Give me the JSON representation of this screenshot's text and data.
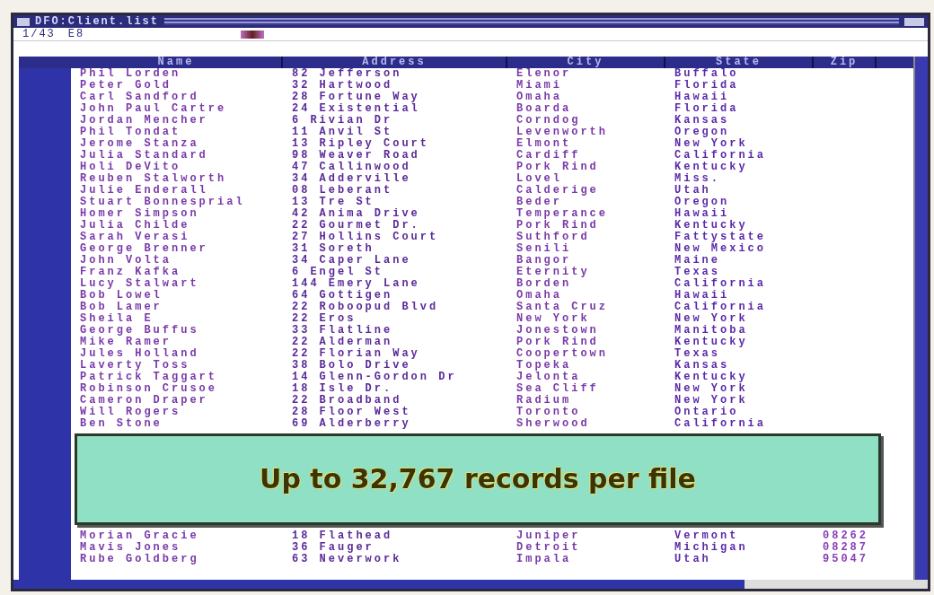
{
  "window": {
    "title": "DFO:Client.list",
    "record_position": "1/43",
    "field_code": "E8"
  },
  "table": {
    "columns": [
      "Name",
      "Address",
      "City",
      "State",
      "Zip"
    ],
    "rows": [
      {
        "name": "Phil Lorden",
        "address": "82 Jefferson",
        "city": "Elenor",
        "state": "Buffalo"
      },
      {
        "name": "Peter Gold",
        "address": "32 Hartwood",
        "city": "Miami",
        "state": "Florida"
      },
      {
        "name": "Carl Sandford",
        "address": "28 Fortune Way",
        "city": "Omaha",
        "state": "Hawaii"
      },
      {
        "name": "John Paul Cartre",
        "address": "24 Existential",
        "city": "Boarda",
        "state": "Florida"
      },
      {
        "name": "Jordan Mencher",
        "address": "6 Rivian Dr",
        "city": "Corndog",
        "state": "Kansas"
      },
      {
        "name": "Phil Tondat",
        "address": "11 Anvil St",
        "city": "Levenworth",
        "state": "Oregon"
      },
      {
        "name": "Jerome Stanza",
        "address": "13 Ripley Court",
        "city": "Elmont",
        "state": "New York"
      },
      {
        "name": "Julia Standard",
        "address": "98 Weaver Road",
        "city": "Cardiff",
        "state": "California"
      },
      {
        "name": "Holi DeVito",
        "address": "47 Callinwood",
        "city": "Pork Rind",
        "state": "Kentucky"
      },
      {
        "name": "Reuben Stalworth",
        "address": "34 Adderville",
        "city": "Lovel",
        "state": "Miss."
      },
      {
        "name": "Julie Enderall",
        "address": "08 Leberant",
        "city": "Calderige",
        "state": "Utah"
      },
      {
        "name": "Stuart Bonnesprial",
        "address": "13 Tre St",
        "city": "Beder",
        "state": "Oregon"
      },
      {
        "name": "Homer Simpson",
        "address": "42 Anima Drive",
        "city": "Temperance",
        "state": "Hawaii"
      },
      {
        "name": "Julia Childe",
        "address": "22 Gourmet Dr.",
        "city": "Pork Rind",
        "state": "Kentucky"
      },
      {
        "name": "Sarah Verasi",
        "address": "27 Hollins Court",
        "city": "Suthford",
        "state": "Fattystate"
      },
      {
        "name": "George Brenner",
        "address": "31 Soreth",
        "city": "Senili",
        "state": "New Mexico"
      },
      {
        "name": "John Volta",
        "address": "34 Caper Lane",
        "city": "Bangor",
        "state": "Maine"
      },
      {
        "name": "Franz Kafka",
        "address": "6 Engel St",
        "city": "Eternity",
        "state": "Texas"
      },
      {
        "name": "Lucy Stalwart",
        "address": "144 Emery Lane",
        "city": "Borden",
        "state": "California"
      },
      {
        "name": "Bob Lowel",
        "address": "64 Gottigen",
        "city": "Omaha",
        "state": "Hawaii"
      },
      {
        "name": "Bob Lamer",
        "address": "22 Roboopud Blvd",
        "city": "Santa Cruz",
        "state": "California"
      },
      {
        "name": "Sheila E",
        "address": "22 Eros",
        "city": "New York",
        "state": "New York"
      },
      {
        "name": "George Buffus",
        "address": "33 Flatline",
        "city": "Jonestown",
        "state": "Manitoba"
      },
      {
        "name": "Mike Ramer",
        "address": "22 Alderman",
        "city": "Pork Rind",
        "state": "Kentucky"
      },
      {
        "name": "Jules Holland",
        "address": "22 Florian Way",
        "city": "Coopertown",
        "state": "Texas"
      },
      {
        "name": "Laverty Toss",
        "address": "38 Bolo Drive",
        "city": "Topeka",
        "state": "Kansas"
      },
      {
        "name": "Patrick Taggart",
        "address": "14 Glenn-Gordon Dr",
        "city": "Jelonta",
        "state": "Kentucky"
      },
      {
        "name": "Robinson Crusoe",
        "address": "18 Isle Dr.",
        "city": "Sea Cliff",
        "state": "New York"
      },
      {
        "name": "Cameron Draper",
        "address": "22 Broadband",
        "city": "Radium",
        "state": "New York"
      },
      {
        "name": "Will Rogers",
        "address": "28 Floor West",
        "city": "Toronto",
        "state": "Ontario"
      },
      {
        "name": "Ben Stone",
        "address": "69 Alderberry",
        "city": "Sherwood",
        "state": "California"
      }
    ],
    "rows_after_caption": [
      {
        "name": "Morian Gracie",
        "address": "18 Flathead",
        "city": "Juniper",
        "state": "Vermont",
        "zip": "08262"
      },
      {
        "name": "Mavis Jones",
        "address": "36 Fauger",
        "city": "Detroit",
        "state": "Michigan",
        "zip": "08287"
      },
      {
        "name": "Rube Goldberg",
        "address": "63 Neverwork",
        "city": "Impala",
        "state": "Utah",
        "zip": "95047"
      }
    ]
  },
  "caption": "Up to 32,767 records per file"
}
